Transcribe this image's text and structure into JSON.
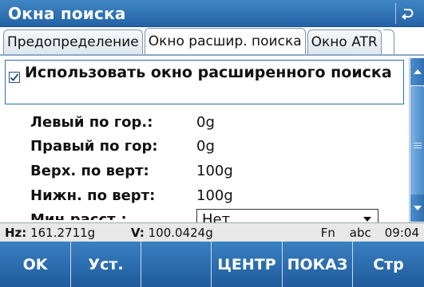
{
  "window": {
    "title": "Окна поиска",
    "back_icon": "return-arrow-icon"
  },
  "tabs": [
    {
      "label": "Предопределение",
      "active": false
    },
    {
      "label": "Окно расшир. поиска",
      "active": true
    },
    {
      "label": "Окно ATR",
      "active": false
    }
  ],
  "form": {
    "use_extended_window": {
      "label": "Использовать окно расширенного поиска",
      "checked": true
    },
    "fields": [
      {
        "label": "Левый по гор.:",
        "value": "0g"
      },
      {
        "label": "Правый по гор:",
        "value": "0g"
      },
      {
        "label": "Верх. по верт:",
        "value": "100g"
      },
      {
        "label": "Нижн. по верт:",
        "value": "100g"
      }
    ],
    "min_distance": {
      "label": "Мин.расст.:",
      "value": "Нет"
    }
  },
  "status": {
    "hz_label": "Hz:",
    "hz_value": "161.2711g",
    "v_label": "V:",
    "v_value": "100.0424g",
    "fn": "Fn",
    "mode": "abc",
    "time": "09:04"
  },
  "softkeys": [
    "OK",
    "Уст.",
    "",
    "ЦЕНТР",
    "ПОКАЗ",
    "Стр"
  ],
  "colors": {
    "accent": "#2a6aad",
    "statusbar": "#e8e8e8"
  }
}
